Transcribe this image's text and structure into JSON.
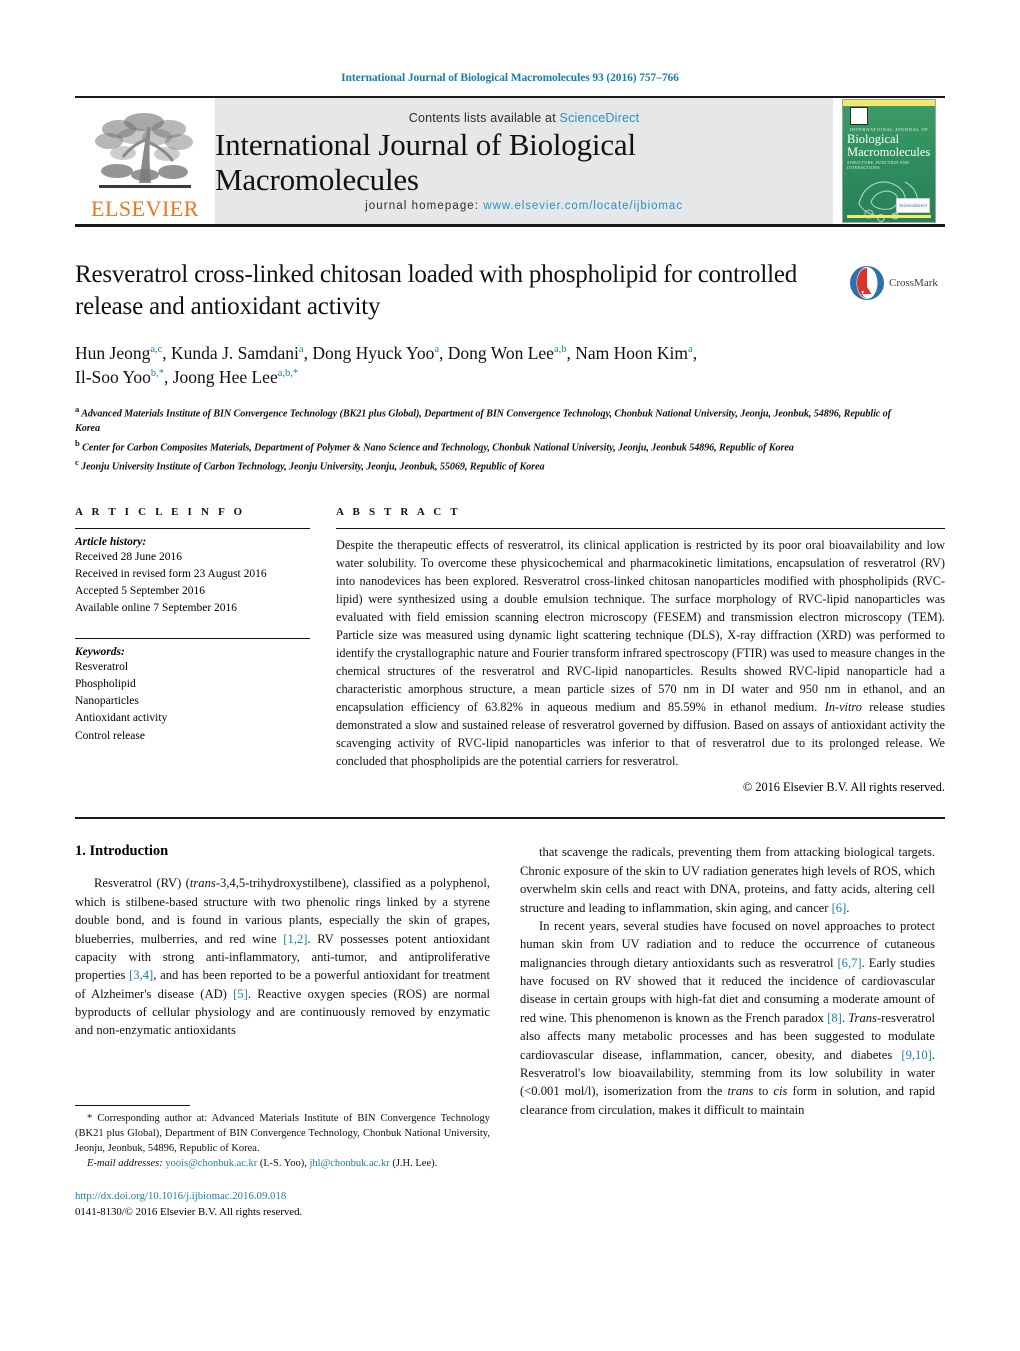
{
  "running_head": "International Journal of Biological Macromolecules 93 (2016) 757–766",
  "masthead": {
    "publisher_name": "ELSEVIER",
    "contents_prefix": "Contents lists available at ",
    "contents_link": "ScienceDirect",
    "journal_title": "International Journal of Biological Macromolecules",
    "homepage_prefix": "journal homepage: ",
    "homepage_url": "www.elsevier.com/locate/ijbiomac",
    "cover": {
      "kicker": "INTERNATIONAL JOURNAL OF",
      "name_line1": "Biological",
      "name_line2": "Macromolecules",
      "subtitle": "STRUCTURE, FUNCTION AND INTERACTIONS",
      "badge": "ScienceDirect"
    }
  },
  "article": {
    "title": "Resveratrol cross-linked chitosan loaded with phospholipid for controlled release and antioxidant activity",
    "crossmark_label": "CrossMark",
    "authors_line1": "Hun Jeong<sup>a,c</sup>, Kunda J. Samdani<sup>a</sup>, Dong Hyuck Yoo<sup>a</sup>, Dong Won Lee<sup>a,b</sup>, Nam Hoon Kim<sup>a</sup>,",
    "authors_line2": "Il-Soo Yoo<sup>b,*</sup>, Joong Hee Lee<sup>a,b,*</sup>",
    "affiliations": [
      "<sup>a</sup> Advanced Materials Institute of BIN Convergence Technology (BK21 plus Global), Department of BIN Convergence Technology, Chonbuk National University, Jeonju, Jeonbuk, 54896, Republic of Korea",
      "<sup>b</sup> Center for Carbon Composites Materials, Department of Polymer &amp; Nano Science and Technology, Chonbuk National University, Jeonju, Jeonbuk 54896, Republic of Korea",
      "<sup>c</sup> Jeonju University Institute of Carbon Technology, Jeonju University, Jeonju, Jeonbuk, 55069, Republic of Korea"
    ]
  },
  "article_info": {
    "heading": "A R T I C L E   I N F O",
    "history_label": "Article history:",
    "history": [
      "Received 28 June 2016",
      "Received in revised form 23 August 2016",
      "Accepted 5 September 2016",
      "Available online 7 September 2016"
    ],
    "keywords_label": "Keywords:",
    "keywords": [
      "Resveratrol",
      "Phospholipid",
      "Nanoparticles",
      "Antioxidant activity",
      "Control release"
    ]
  },
  "abstract": {
    "heading": "A B S T R A C T",
    "body": "Despite the therapeutic effects of resveratrol, its clinical application is restricted by its poor oral bioavailability and low water solubility. To overcome these physicochemical and pharmacokinetic limitations, encapsulation of resveratrol (RV) into nanodevices has been explored. Resveratrol cross-linked chitosan nanoparticles modified with phospholipids (RVC-lipid) were synthesized using a double emulsion technique. The surface morphology of RVC-lipid nanoparticles was evaluated with field emission scanning electron microscopy (FESEM) and transmission electron microscopy (TEM). Particle size was measured using dynamic light scattering technique (DLS), X-ray diffraction (XRD) was performed to identify the crystallographic nature and Fourier transform infrared spectroscopy (FTIR) was used to measure changes in the chemical structures of the resveratrol and RVC-lipid nanoparticles. Results showed RVC-lipid nanoparticle had a characteristic amorphous structure, a mean particle sizes of 570 nm in DI water and 950 nm in ethanol, and an encapsulation efficiency of 63.82% in aqueous medium and 85.59% in ethanol medium. <i>In-vitro</i> release studies demonstrated a slow and sustained release of resveratrol governed by diffusion. Based on assays of antioxidant activity the scavenging activity of RVC-lipid nanoparticles was inferior to that of resveratrol due to its prolonged release. We concluded that phospholipids are the potential carriers for resveratrol.",
    "copyright": "© 2016 Elsevier B.V. All rights reserved."
  },
  "introduction": {
    "heading": "1.  Introduction",
    "left_paragraph": "Resveratrol (RV) (<i>trans</i>-3,4,5-trihydroxystilbene), classified as a polyphenol, which is stilbene-based structure with two phenolic rings linked by a styrene double bond, and is found in various plants, especially the skin of grapes, blueberries, mulberries, and red wine <span class=\"ref\">[1,2]</span>. RV possesses potent antioxidant capacity with strong anti-inflammatory, anti-tumor, and antiproliferative properties <span class=\"ref\">[3,4]</span>, and has been reported to be a powerful antioxidant for treatment of Alzheimer's disease (AD) <span class=\"ref\">[5]</span>. Reactive oxygen species (ROS) are normal byproducts of cellular physiology and are continuously removed by enzymatic and non-enzymatic antioxidants",
    "right_paragraph_1": "that scavenge the radicals, preventing them from attacking biological targets. Chronic exposure of the skin to UV radiation generates high levels of ROS, which overwhelm skin cells and react with DNA, proteins, and fatty acids, altering cell structure and leading to inflammation, skin aging, and cancer <span class=\"ref\">[6]</span>.",
    "right_paragraph_2": "In recent years, several studies have focused on novel approaches to protect human skin from UV radiation and to reduce the occurrence of cutaneous malignancies through dietary antioxidants such as resveratrol <span class=\"ref\">[6,7]</span>. Early studies have focused on RV showed that it reduced the incidence of cardiovascular disease in certain groups with high-fat diet and consuming a moderate amount of red wine. This phenomenon is known as the French paradox <span class=\"ref\">[8]</span>. <i>Trans</i>-resveratrol also affects many metabolic processes and has been suggested to modulate cardiovascular disease, inflammation, cancer, obesity, and diabetes <span class=\"ref\">[9,10]</span>. Resveratrol's low bioavailability, stemming from its low solubility in water (&lt;0.001 mol/l), isomerization from the <i>trans</i> to <i>cis</i> form in solution, and rapid clearance from circulation, makes it difficult to maintain"
  },
  "footnote": {
    "corresponding": "* Corresponding author at: Advanced Materials Institute of BIN Convergence Technology (BK21 plus Global), Department of BIN Convergence Technology, Chonbuk National University, Jeonju, Jeonbuk, 54896, Republic of Korea.",
    "email_label": "E-mail addresses:",
    "email_1": "yoois@chonbuk.ac.kr",
    "email_1_owner": "(I.-S. Yoo),",
    "email_2": "jhl@chonbuk.ac.kr",
    "email_2_owner": "(J.H. Lee).",
    "doi": "http://dx.doi.org/10.1016/j.ijbiomac.2016.09.018",
    "issn_line": "0141-8130/© 2016 Elsevier B.V. All rights reserved."
  },
  "colors": {
    "link": "#1a7fa8",
    "elsevier_orange": "#e87722",
    "masthead_gray": "#e6e7e8",
    "cover_green": "#2f8f5d"
  }
}
